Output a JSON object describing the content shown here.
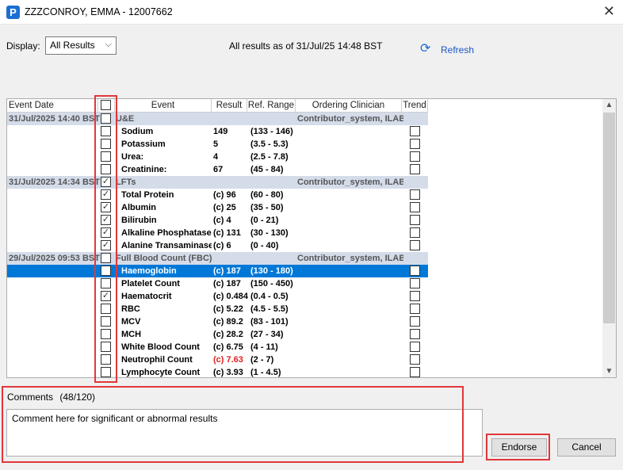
{
  "window": {
    "title": "ZZZCONROY, EMMA  - 12007662"
  },
  "toolbar": {
    "display_label": "Display:",
    "display_value": "All Results",
    "as_of": "All results as of 31/Jul/25 14:48 BST",
    "refresh_label": "Refresh"
  },
  "columns": {
    "event_date": "Event Date",
    "event": "Event",
    "result": "Result",
    "ref_range": "Ref. Range",
    "ordering_clinician": "Ordering Clinician",
    "trend": "Trend"
  },
  "rows": [
    {
      "type": "group",
      "date": "31/Jul/2025 14:40 BST",
      "event": "U&E",
      "clinician": "Contributor_system, ILAB",
      "checked": false
    },
    {
      "type": "item",
      "event": "Sodium",
      "result": "149",
      "range": "(133 - 146)",
      "checked": false
    },
    {
      "type": "item",
      "event": "Potassium",
      "result": "5",
      "range": "(3.5 - 5.3)",
      "checked": false
    },
    {
      "type": "item",
      "event": "Urea:",
      "result": "4",
      "range": "(2.5 - 7.8)",
      "checked": false
    },
    {
      "type": "item",
      "event": "Creatinine:",
      "result": "67",
      "range": "(45 - 84)",
      "checked": false
    },
    {
      "type": "group",
      "date": "31/Jul/2025 14:34 BST",
      "event": "LFTs",
      "clinician": "Contributor_system, ILAB",
      "checked": true
    },
    {
      "type": "item",
      "event": "Total Protein",
      "result": "(c) 96",
      "range": "(60 - 80)",
      "checked": true
    },
    {
      "type": "item",
      "event": "Albumin",
      "result": "(c) 25",
      "range": "(35 - 50)",
      "checked": true
    },
    {
      "type": "item",
      "event": "Bilirubin",
      "result": "(c) 4",
      "range": "(0 - 21)",
      "checked": true
    },
    {
      "type": "item",
      "event": "Alkaline Phosphatase",
      "result": "(c) 131",
      "range": "(30 - 130)",
      "checked": true
    },
    {
      "type": "item",
      "event": "Alanine Transaminase *",
      "result": "(c) 6",
      "range": "(0 - 40)",
      "checked": true
    },
    {
      "type": "group",
      "date": "29/Jul/2025 09:53 BST",
      "event": "Full Blood Count (FBC)",
      "clinician": "Contributor_system, ILAB",
      "checked": false
    },
    {
      "type": "item",
      "event": "Haemoglobin",
      "result": "(c) 187",
      "range": "(130 - 180)",
      "checked": false,
      "selected": true
    },
    {
      "type": "item",
      "event": "Platelet Count",
      "result": "(c) 187",
      "range": "(150 - 450)",
      "checked": false
    },
    {
      "type": "item",
      "event": "Haematocrit",
      "result": "(c) 0.484",
      "range": "(0.4 - 0.5)",
      "checked": true
    },
    {
      "type": "item",
      "event": "RBC",
      "result": "(c) 5.22",
      "range": "(4.5 - 5.5)",
      "checked": false
    },
    {
      "type": "item",
      "event": "MCV",
      "result": "(c) 89.2",
      "range": "(83 - 101)",
      "checked": false
    },
    {
      "type": "item",
      "event": "MCH",
      "result": "(c) 28.2",
      "range": "(27 - 34)",
      "checked": false
    },
    {
      "type": "item",
      "event": "White Blood Count",
      "result": "(c) 6.75",
      "range": "(4 - 11)",
      "checked": false
    },
    {
      "type": "item",
      "event": "Neutrophil Count",
      "result": "(c) 7.63",
      "range": "(2 - 7)",
      "checked": false,
      "abnormal": true
    },
    {
      "type": "item",
      "event": "Lymphocyte Count",
      "result": "(c) 3.93",
      "range": "(1 - 4.5)",
      "checked": false
    }
  ],
  "comments": {
    "label": "Comments",
    "count": "(48/120)",
    "text": "Comment here for significant or abnormal results"
  },
  "buttons": {
    "endorse": "Endorse",
    "cancel": "Cancel"
  },
  "colors": {
    "highlight": "#e0373b",
    "selection": "#0078d7",
    "group_row": "#d4dcea",
    "abnormal": "#e02020"
  }
}
